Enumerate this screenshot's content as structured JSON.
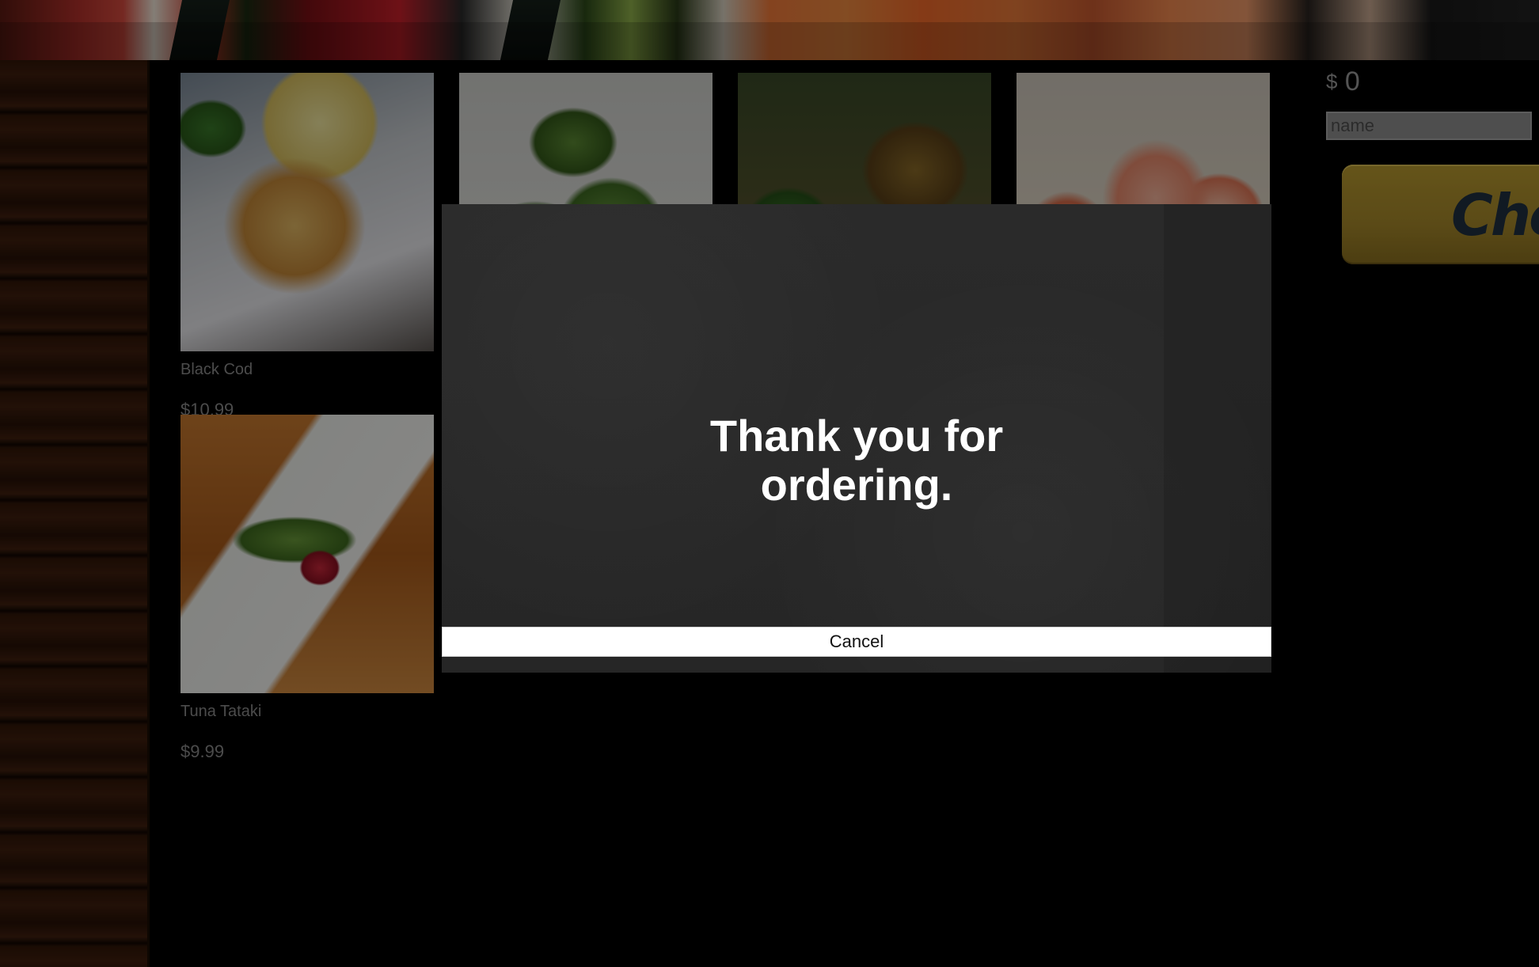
{
  "header": {
    "banner_image": "sushi-banner-image"
  },
  "menu": {
    "items": [
      {
        "name": "Black Cod",
        "price": "$10.99",
        "image": "black-cod-photo"
      },
      {
        "name": "",
        "price": "",
        "image": "edamame-photo"
      },
      {
        "name": "",
        "price": "",
        "image": "grilled-vegetables-photo"
      },
      {
        "name": "",
        "price": "",
        "image": "sashimi-photo"
      },
      {
        "name": "Tuna Tataki",
        "price": "$9.99",
        "image": "tuna-tataki-photo"
      }
    ]
  },
  "cart": {
    "currency": "$",
    "total": "0",
    "name_placeholder": "name",
    "name_value": "",
    "checkout_label": "Che"
  },
  "modal": {
    "message": "Thank you for ordering.",
    "cancel_label": "Cancel"
  },
  "colors": {
    "checkout_button": "#a6882a",
    "modal_background": "#2a2a2a",
    "cancel_button": "#ffffff"
  }
}
